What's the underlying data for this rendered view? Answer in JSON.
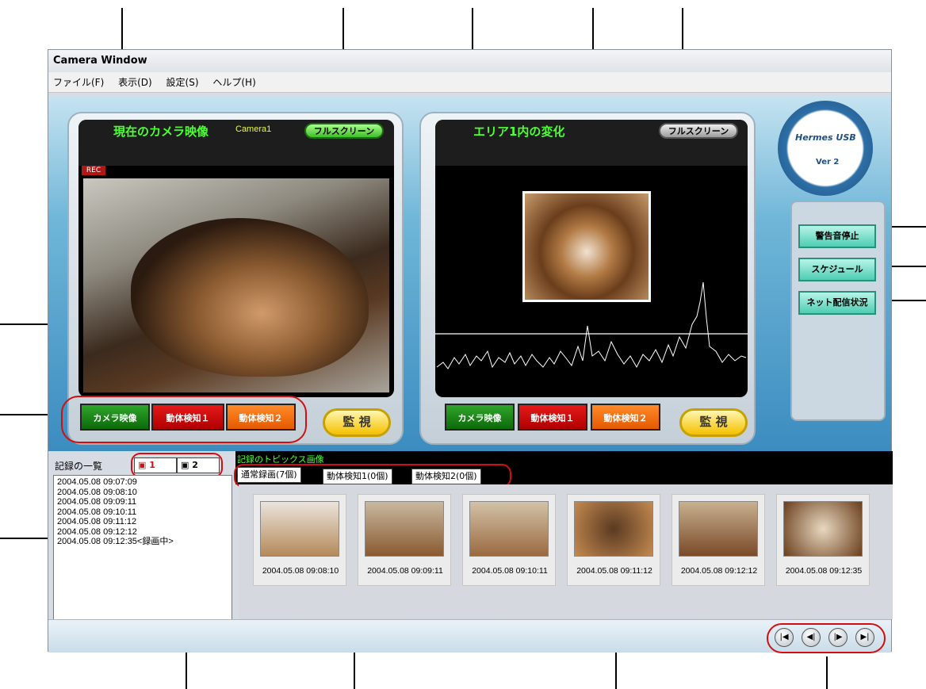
{
  "window": {
    "title": "Camera Window"
  },
  "menu": [
    "ファイル(F)",
    "表示(D)",
    "設定(S)",
    "ヘルプ(H)"
  ],
  "left_panel": {
    "title": "現在のカメラ映像",
    "camera_label": "Camera1",
    "fullscreen": "フルスクリーン",
    "rec_badge": "REC",
    "modes": [
      "カメラ映像",
      "動体検知１",
      "動体検知２"
    ],
    "watch": "監 視"
  },
  "right_panel": {
    "title": "エリア1内の変化",
    "fullscreen": "フルスクリーン",
    "modes": [
      "カメラ映像",
      "動体検知１",
      "動体検知２"
    ],
    "watch": "監 視"
  },
  "logo": {
    "text": "Hermes USB",
    "version": "Ver 2"
  },
  "side_buttons": [
    "警告音停止",
    "スケジュール",
    "ネット配信状況"
  ],
  "records": {
    "title": "記録の一覧",
    "camera_tabs": [
      "1",
      "2"
    ],
    "items": [
      "2004.05.08 09:07:09",
      "2004.05.08 09:08:10",
      "2004.05.08 09:09:11",
      "2004.05.08 09:10:11",
      "2004.05.08 09:11:12",
      "2004.05.08 09:12:12",
      "2004.05.08 09:12:35<録画中>"
    ]
  },
  "topics": {
    "title": "記録のトピックス画像",
    "tabs": [
      "通常録画(7個)",
      "動体検知1(0個)",
      "動体検知2(0個)"
    ],
    "thumbnails": [
      "2004.05.08 09:08:10",
      "2004.05.08 09:09:11",
      "2004.05.08 09:10:11",
      "2004.05.08 09:11:12",
      "2004.05.08 09:12:12",
      "2004.05.08 09:12:35"
    ]
  },
  "nav_buttons": [
    "first-icon",
    "step-back-icon",
    "step-forward-icon",
    "last-icon"
  ],
  "colors": {
    "title_green": "#4cff32",
    "accent_blue": "#3b8cc0",
    "callout_red": "#d01010"
  }
}
